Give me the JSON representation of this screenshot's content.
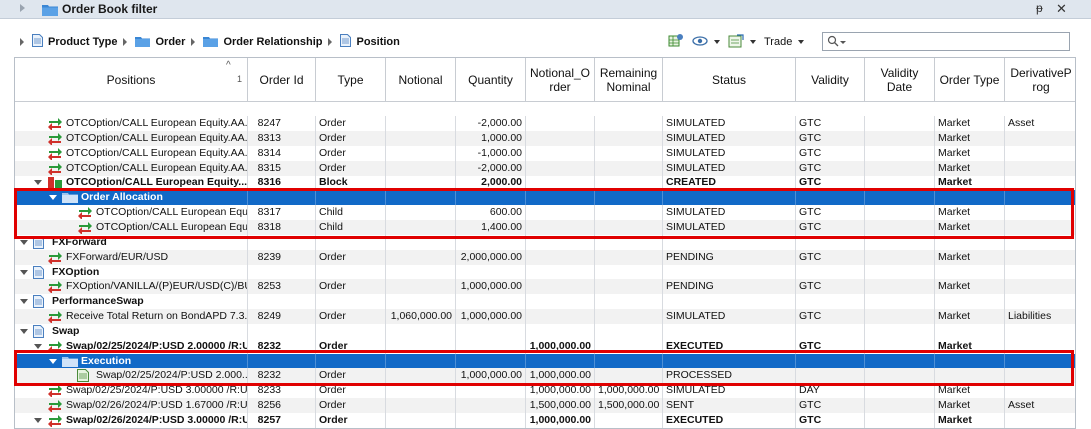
{
  "window": {
    "title": "Order Book filter",
    "pin": "ᵽ",
    "close": "✕"
  },
  "toolbar": {
    "breadcrumbs": [
      "Product Type",
      "Order",
      "Order Relationship",
      "Position"
    ],
    "trade_label": "Trade",
    "search_placeholder": ""
  },
  "columns": {
    "positions": "Positions",
    "sort_indicator": "1",
    "order_id": "Order Id",
    "type": "Type",
    "notional": "Notional",
    "quantity": "Quantity",
    "notional_order": "Notional_O rder",
    "remaining_nominal": "Remaining Nominal",
    "status": "Status",
    "validity": "Validity",
    "validity_date": "Validity Date",
    "order_type": "Order Type",
    "derivative_prog": "DerivativeP rog"
  },
  "rows": [
    {
      "kind": "order",
      "indent": 2,
      "icon": "arrows",
      "pos": "OTCOption/CALL European Equity.AA...",
      "id": "8247",
      "type": "Order",
      "notional": "",
      "qty": "-2,000.00",
      "notional_order": "",
      "remaining": "",
      "status": "SIMULATED",
      "validity": "GTC",
      "vdate": "",
      "otype": "Market",
      "deriv": "Asset"
    },
    {
      "kind": "order",
      "indent": 2,
      "icon": "arrows",
      "pos": "OTCOption/CALL European Equity.AA...",
      "id": "8313",
      "type": "Order",
      "notional": "",
      "qty": "1,000.00",
      "notional_order": "",
      "remaining": "",
      "status": "SIMULATED",
      "validity": "GTC",
      "vdate": "",
      "otype": "Market",
      "deriv": ""
    },
    {
      "kind": "order",
      "indent": 2,
      "icon": "arrows",
      "pos": "OTCOption/CALL European Equity.AA...",
      "id": "8314",
      "type": "Order",
      "notional": "",
      "qty": "-1,000.00",
      "notional_order": "",
      "remaining": "",
      "status": "SIMULATED",
      "validity": "GTC",
      "vdate": "",
      "otype": "Market",
      "deriv": ""
    },
    {
      "kind": "order",
      "indent": 2,
      "icon": "arrows",
      "pos": "OTCOption/CALL European Equity.AA...",
      "id": "8315",
      "type": "Order",
      "notional": "",
      "qty": "-2,000.00",
      "notional_order": "",
      "remaining": "",
      "status": "SIMULATED",
      "validity": "GTC",
      "vdate": "",
      "otype": "Market",
      "deriv": ""
    },
    {
      "kind": "bold",
      "indent": 2,
      "icon": "block",
      "expander": true,
      "pos": "OTCOption/CALL European Equity....",
      "id": "8316",
      "type": "Block",
      "notional": "",
      "qty": "2,000.00",
      "notional_order": "",
      "remaining": "",
      "status": "CREATED",
      "validity": "GTC",
      "vdate": "",
      "otype": "Market",
      "deriv": ""
    },
    {
      "kind": "sel",
      "indent": 3,
      "icon": "folder",
      "expander": true,
      "pos": "Order Allocation",
      "id": "",
      "type": "",
      "notional": "",
      "qty": "",
      "notional_order": "",
      "remaining": "",
      "status": "",
      "validity": "",
      "vdate": "",
      "otype": "",
      "deriv": ""
    },
    {
      "kind": "order",
      "indent": 4,
      "icon": "arrows",
      "pos": "OTCOption/CALL European Equi...",
      "id": "8317",
      "type": "Child",
      "notional": "",
      "qty": "600.00",
      "notional_order": "",
      "remaining": "",
      "status": "SIMULATED",
      "validity": "GTC",
      "vdate": "",
      "otype": "Market",
      "deriv": ""
    },
    {
      "kind": "order",
      "indent": 4,
      "icon": "arrows",
      "pos": "OTCOption/CALL European Equi...",
      "id": "8318",
      "type": "Child",
      "notional": "",
      "qty": "1,400.00",
      "notional_order": "",
      "remaining": "",
      "status": "SIMULATED",
      "validity": "GTC",
      "vdate": "",
      "otype": "Market",
      "deriv": ""
    },
    {
      "kind": "group",
      "indent": 1,
      "icon": "doc",
      "expander": true,
      "pos": "FXForward",
      "id": "",
      "type": "",
      "notional": "",
      "qty": "",
      "notional_order": "",
      "remaining": "",
      "status": "",
      "validity": "",
      "vdate": "",
      "otype": "",
      "deriv": ""
    },
    {
      "kind": "order",
      "indent": 2,
      "icon": "arrows",
      "pos": "FXForward/EUR/USD",
      "id": "8239",
      "type": "Order",
      "notional": "",
      "qty": "2,000,000.00",
      "notional_order": "",
      "remaining": "",
      "status": "PENDING",
      "validity": "GTC",
      "vdate": "",
      "otype": "Market",
      "deriv": ""
    },
    {
      "kind": "group",
      "indent": 1,
      "icon": "doc",
      "expander": true,
      "pos": "FXOption",
      "id": "",
      "type": "",
      "notional": "",
      "qty": "",
      "notional_order": "",
      "remaining": "",
      "status": "",
      "validity": "",
      "vdate": "",
      "otype": "",
      "deriv": ""
    },
    {
      "kind": "order",
      "indent": 2,
      "icon": "arrows",
      "pos": "FXOption/VANILLA/(P)EUR/USD(C)/BU...",
      "id": "8253",
      "type": "Order",
      "notional": "",
      "qty": "1,000,000.00",
      "notional_order": "",
      "remaining": "",
      "status": "PENDING",
      "validity": "GTC",
      "vdate": "",
      "otype": "Market",
      "deriv": ""
    },
    {
      "kind": "group",
      "indent": 1,
      "icon": "doc",
      "expander": true,
      "pos": "PerformanceSwap",
      "id": "",
      "type": "",
      "notional": "",
      "qty": "",
      "notional_order": "",
      "remaining": "",
      "status": "",
      "validity": "",
      "vdate": "",
      "otype": "",
      "deriv": ""
    },
    {
      "kind": "order",
      "indent": 2,
      "icon": "arrows",
      "pos": "Receive Total Return on BondAPD 7.3...",
      "id": "8249",
      "type": "Order",
      "notional": "1,060,000.00",
      "qty": "1,000,000.00",
      "notional_order": "",
      "remaining": "",
      "status": "SIMULATED",
      "validity": "GTC",
      "vdate": "",
      "otype": "Market",
      "deriv": "Liabilities"
    },
    {
      "kind": "group",
      "indent": 1,
      "icon": "doc",
      "expander": true,
      "pos": "Swap",
      "id": "",
      "type": "",
      "notional": "",
      "qty": "",
      "notional_order": "",
      "remaining": "",
      "status": "",
      "validity": "",
      "vdate": "",
      "otype": "",
      "deriv": ""
    },
    {
      "kind": "bold",
      "indent": 2,
      "icon": "arrows",
      "expander": true,
      "pos": "Swap/02/25/2024/P:USD 2.00000 /R:U...",
      "id": "8232",
      "type": "Order",
      "notional": "",
      "qty": "",
      "notional_order": "1,000,000.00",
      "remaining": "",
      "status": "EXECUTED",
      "validity": "GTC",
      "vdate": "",
      "otype": "Market",
      "deriv": ""
    },
    {
      "kind": "sel",
      "indent": 3,
      "icon": "folder",
      "expander": true,
      "pos": "Execution",
      "id": "",
      "type": "",
      "notional": "",
      "qty": "",
      "notional_order": "",
      "remaining": "",
      "status": "",
      "validity": "",
      "vdate": "",
      "otype": "",
      "deriv": ""
    },
    {
      "kind": "order",
      "indent": 4,
      "icon": "exec",
      "pos": "Swap/02/25/2024/P:USD 2.000...",
      "id": "8232",
      "type": "Order",
      "notional": "",
      "qty": "1,000,000.00",
      "notional_order": "1,000,000.00",
      "remaining": "",
      "status": "PROCESSED",
      "validity": "",
      "vdate": "",
      "otype": "",
      "deriv": ""
    },
    {
      "kind": "order",
      "indent": 2,
      "icon": "arrows",
      "pos": "Swap/02/25/2024/P:USD 3.00000 /R:U...",
      "id": "8233",
      "type": "Order",
      "notional": "",
      "qty": "",
      "notional_order": "1,000,000.00",
      "remaining": "1,000,000.00",
      "status": "SIMULATED",
      "validity": "DAY",
      "vdate": "",
      "otype": "Market",
      "deriv": ""
    },
    {
      "kind": "order",
      "indent": 2,
      "icon": "arrows",
      "pos": "Swap/02/26/2024/P:USD 1.67000 /R:U...",
      "id": "8256",
      "type": "Order",
      "notional": "",
      "qty": "",
      "notional_order": "1,500,000.00",
      "remaining": "1,500,000.00",
      "status": "SENT",
      "validity": "GTC",
      "vdate": "",
      "otype": "Market",
      "deriv": "Asset"
    },
    {
      "kind": "bold",
      "indent": 2,
      "icon": "arrows",
      "expander": true,
      "pos": "Swap/02/26/2024/P:USD 3.00000 /R:U...",
      "id": "8257",
      "type": "Order",
      "notional": "",
      "qty": "",
      "notional_order": "1,000,000.00",
      "remaining": "",
      "status": "EXECUTED",
      "validity": "GTC",
      "vdate": "",
      "otype": "Market",
      "deriv": ""
    }
  ],
  "colors": {
    "selection": "#1169c7",
    "highlight": "#e00000",
    "alt_row": "#f2f2f2"
  }
}
